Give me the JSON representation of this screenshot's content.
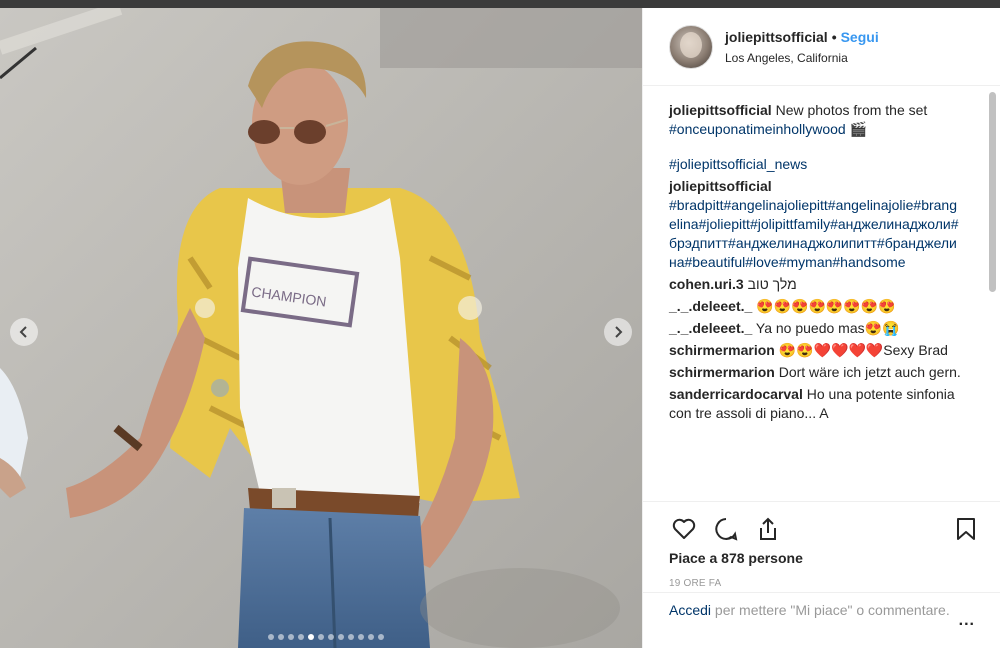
{
  "post": {
    "username": "joliepittsofficial",
    "separator": "•",
    "follow_label": "Segui",
    "location": "Los Angeles, California"
  },
  "comments": [
    {
      "user": "joliepittsofficial",
      "text": "New photos from the set ",
      "tags": "#onceuponatimeinhollywood 🎬"
    },
    {
      "user": "",
      "text": "",
      "tags": "#joliepittsofficial_news"
    },
    {
      "user": "joliepittsofficial",
      "text": "",
      "tags": "#bradpitt#angelinajoliepitt#angelinajolie#brangelina#joliepitt#jolipittfamily#анджелинаджоли#брэдпитт#анджелинаджолипитт#бранджелина#beautiful#love#myman#handsome"
    },
    {
      "user": "cohen.uri.3",
      "text": "מלך טוב",
      "tags": ""
    },
    {
      "user": "_._.deleeet._",
      "text": "😍😍😍😍😍😍😍😍",
      "tags": ""
    },
    {
      "user": "_._.deleeet._",
      "text": "Ya no puedo mas😍😭",
      "tags": ""
    },
    {
      "user": "schirmermarion",
      "text": "😍😍❤️❤️❤️❤️Sexy Brad",
      "tags": ""
    },
    {
      "user": "schirmermarion",
      "text": "Dort wäre ich jetzt auch gern.",
      "tags": ""
    },
    {
      "user": "sanderricardocarval",
      "text": "Ho una potente sinfonia con tre assoli di piano... A",
      "tags": ""
    }
  ],
  "actions": {
    "like_icon": "heart-icon",
    "comment_icon": "speech-bubble-icon",
    "share_icon": "share-icon",
    "save_icon": "bookmark-icon",
    "likes_text": "Piace a 878 persone",
    "time_ago": "19 ORE FA"
  },
  "add_comment": {
    "login_link": "Accedi",
    "prompt": " per mettere \"Mi piace\" o commentare.",
    "more_label": "..."
  },
  "carousel": {
    "total_dots": 12,
    "active_index": 4
  }
}
